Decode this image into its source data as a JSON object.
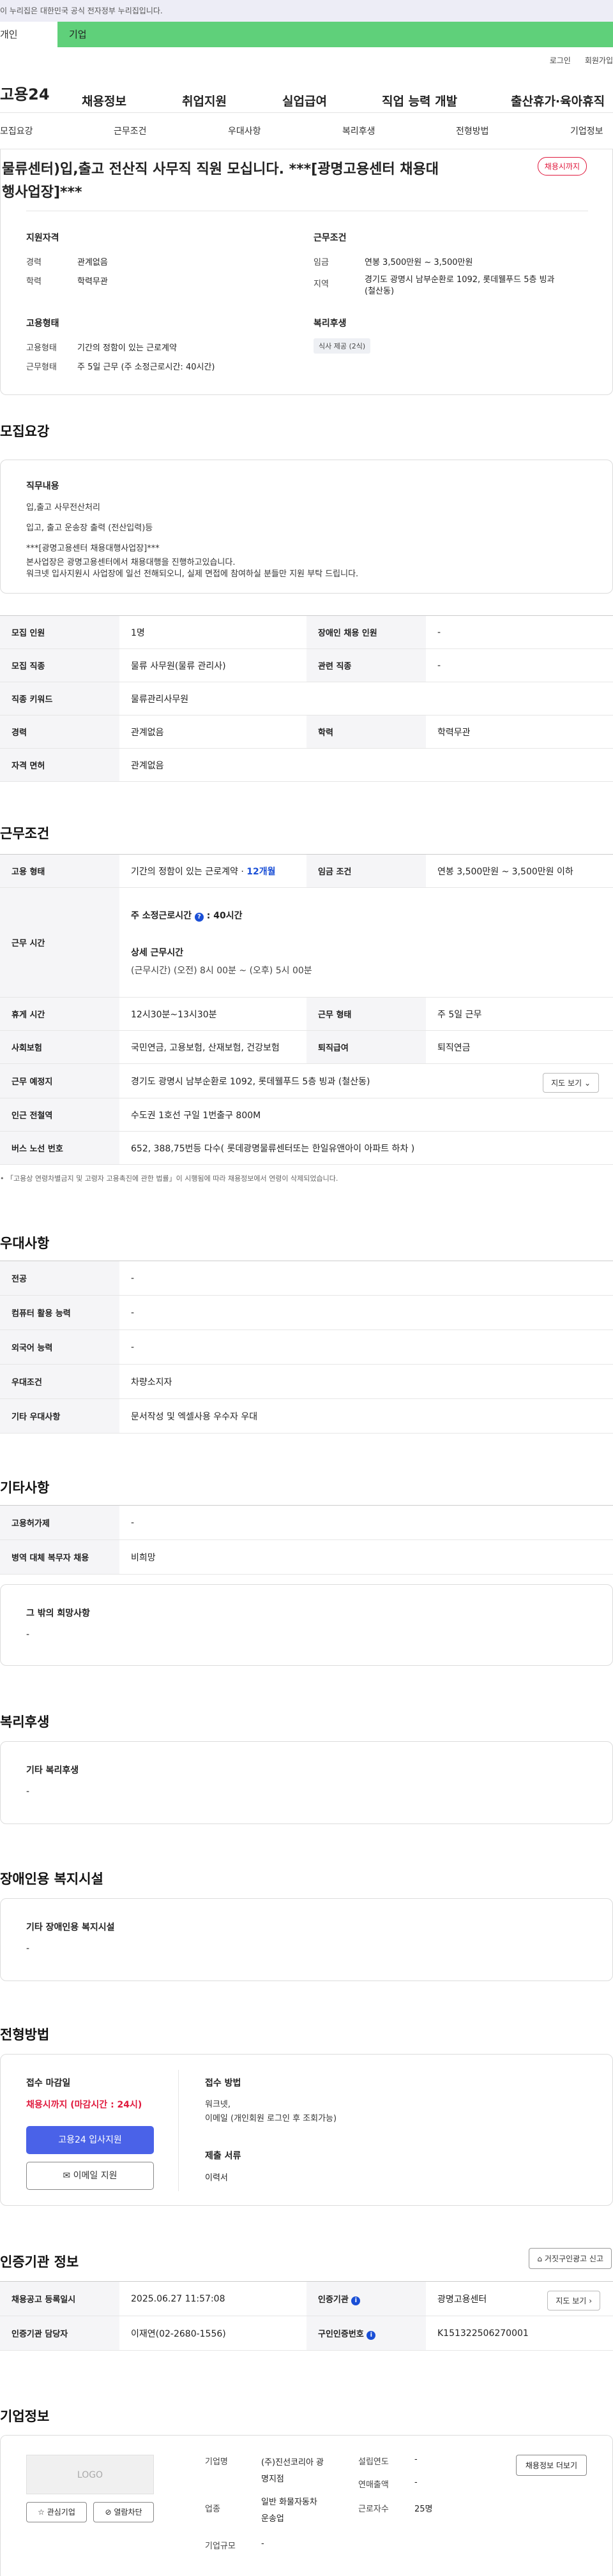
{
  "banner": "이 누리집은 대한민국 공식 전자정부 누리집입니다.",
  "tabs": {
    "individual": "개인",
    "business": "기업"
  },
  "util": {
    "login": "로그인",
    "join": "회원가입"
  },
  "gnb": {
    "logo": "고용24",
    "menu": [
      "채용정보",
      "취업지원",
      "실업급여",
      "직업 능력 개발",
      "출산휴가·육아휴직"
    ]
  },
  "subnav": [
    "모집요강",
    "근무조건",
    "우대사항",
    "복리후생",
    "전형방법",
    "기업정보"
  ],
  "job": {
    "title_line1": "물류센터)입,출고 전산직 사무직 직원 모십니다. ***[광명고용센터 채용대",
    "title_line2": "행사업장]***",
    "badge": "채용시까지",
    "qual_title": "지원자격",
    "career_label": "경력",
    "career_value": "관계없음",
    "edu_label": "학력",
    "edu_value": "학력무관",
    "cond_title": "근무조건",
    "wage_label": "임금",
    "wage_value": "연봉 3,500만원 ~ 3,500만원",
    "loc_label": "지역",
    "loc_line1": "경기도 광명시 남부순환로 1092, 롯데웰푸드 5층 빙과",
    "loc_line2": "(철산동)",
    "emp_title": "고용형태",
    "emp_label": "고용형태",
    "emp_value": "기간의 정함이 있는 근로계약",
    "work_label": "근무형태",
    "work_value": "주 5일 근무 (주 소정근로시간: 40시간)",
    "welfare_title": "복리후생",
    "welfare_tag": "식사 제공 (2식)"
  },
  "recruit": {
    "title": "모집요강",
    "duty_title": "직무내용",
    "duty_lines": [
      "입,출고 사무전산처리",
      "입고, 출고 운송장 출력 (전산입력)등",
      "***[광명고용센터 채용대행사업장]***",
      "본사업장은 광명고용센터에서 채용대행을 진행하고있습니다.",
      "워크넷 입사지원시 사업장에 일선 전해되오니, 실제 면접에 참여하실 분들만 지원 부탁 드립니다."
    ],
    "rows": {
      "count_h": "모집 인원",
      "count_v": "1명",
      "disab_h": "장애인 채용 인원",
      "disab_v": "-",
      "job_h": "모집 직종",
      "job_v": "물류 사무원(물류 관리사)",
      "rel_h": "관련 직종",
      "rel_v": "-",
      "kw_h": "직종 키워드",
      "kw_v": "물류관리사무원",
      "career_h": "경력",
      "career_v": "관계없음",
      "edu_h": "학력",
      "edu_v": "학력무관",
      "lic_h": "자격 면허",
      "lic_v": "관계없음"
    }
  },
  "cond": {
    "title": "근무조건",
    "emp_h": "고용 형태",
    "emp_v": "기간의 정함이 있는 근로계약 · ",
    "emp_months": "12개월",
    "wage_h": "임금 조건",
    "wage_v": "연봉 3,500만원 ~ 3,500만원 이하",
    "time_h": "근무 시간",
    "weekly": "주 소정근로시간",
    "weekly_v": ": 40시간",
    "detail_title": "상세 근무시간",
    "detail_v": "(근무시간) (오전) 8시 00분 ~ (오후) 5시 00분",
    "rest_h": "휴게 시간",
    "rest_v": "12시30분~13시30분",
    "form_h": "근무 형태",
    "form_v": "주 5일 근무",
    "ins_h": "사회보험",
    "ins_v": "국민연금, 고용보험, 산재보험, 건강보험",
    "ret_h": "퇴직급여",
    "ret_v": "퇴직연금",
    "place_h": "근무 예정지",
    "place_v": "경기도 광명시 남부순환로 1092, 롯데웰푸드 5층 빙과 (철산동)",
    "map_btn": "지도 보기",
    "sub_h": "인근 전철역",
    "sub_v": "수도권 1호선 구일 1번출구 800M",
    "bus_h": "버스 노선 번호",
    "bus_v": "652, 388,75번등 다수( 롯데광명물류센터또는 한일유앤아이 아파트 하차 )",
    "note": "「고용상 연령차별금지 및 고령자 고용촉진에 관한 법률」이 시행됨에 따라 채용정보에서 연령이 삭제되었습니다."
  },
  "pref": {
    "title": "우대사항",
    "major_h": "전공",
    "major_v": "-",
    "pc_h": "컴퓨터 활용 능력",
    "pc_v": "-",
    "lang_h": "외국어 능력",
    "lang_v": "-",
    "cond_h": "우대조건",
    "cond_v": "차량소지자",
    "etc_h": "기타 우대사항",
    "etc_v": "문서작성 및 엑셀사용 우수자 우대"
  },
  "etc": {
    "title": "기타사항",
    "empsub_h": "고용허가제",
    "empsub_v": "-",
    "mil_h": "병역 대체 복무자 채용",
    "mil_v": "비희망",
    "other_title": "그 밖의 희망사항",
    "other_v": "-"
  },
  "welfare": {
    "title": "복리후생",
    "box_title": "기타 복리후생",
    "box_v": "-"
  },
  "disab": {
    "title": "장애인용 복지시설",
    "box_title": "기타 장애인용 복지시설",
    "box_v": "-"
  },
  "select": {
    "title": "전형방법",
    "deadline_title": "접수 마감일",
    "deadline_v": "채용시까지 (마감시간 : 24시)",
    "apply_btn": "고용24 입사지원",
    "email_btn": "이메일 지원",
    "method_title": "접수 방법",
    "method_v1": "워크넷,",
    "method_v2": "이메일 (개인회원 로그인 후 조회가능)",
    "docs_title": "제출 서류",
    "docs_v": "이력서"
  },
  "agency": {
    "title": "인증기관 정보",
    "report_btn": "거짓구인광고 신고",
    "reg_h": "채용공고 등록일시",
    "reg_v": "2025.06.27 11:57:08",
    "org_h": "인증기관",
    "org_v": "광명고용센터",
    "map_btn": "지도 보기",
    "mgr_h": "인증기관 담당자",
    "mgr_v": "이재연(02-2680-1556)",
    "no_h": "구인인증번호",
    "no_v": "K151322506270001"
  },
  "company": {
    "title": "기업정보",
    "logo": "LOGO",
    "fav_btn": "관심기업",
    "block_btn": "열람차단",
    "more_btn": "채용정보 더보기",
    "name_h": "기업명",
    "name_v1": "(주)진선코리아 광",
    "name_v2": "명지점",
    "ind_h": "업종",
    "ind_v1": "일반 화물자동차",
    "ind_v2": "운송업",
    "size_h": "기업규모",
    "size_v": "-",
    "year_h": "설립연도",
    "year_v": "-",
    "sales_h": "연매출액",
    "sales_v": "-",
    "emp_h": "근로자수",
    "emp_v": "25명"
  },
  "colors": {
    "green": "#5fd07a",
    "blue": "#1a4fd6",
    "red": "#e0193d",
    "primary_btn": "#4a62e8"
  }
}
